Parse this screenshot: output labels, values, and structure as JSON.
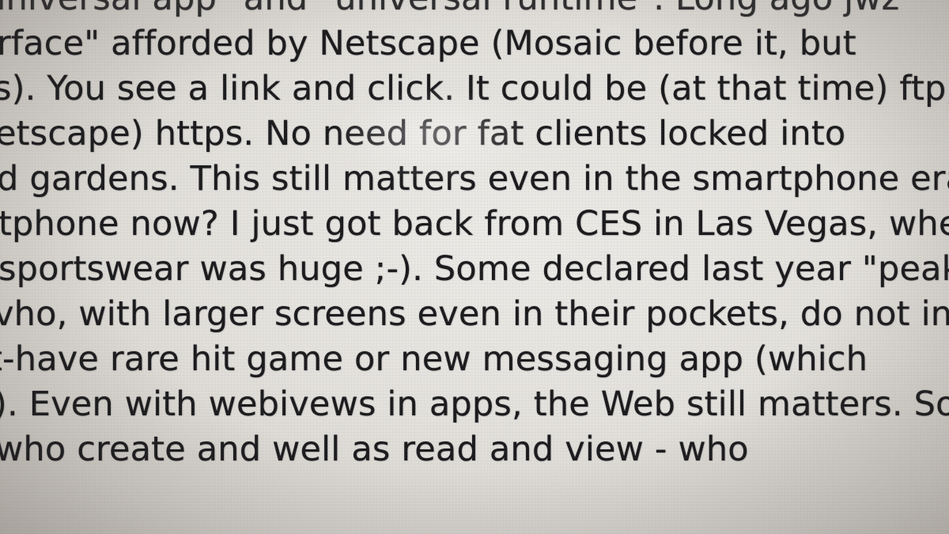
{
  "document": {
    "lines": [
      "universal app\" and \"universal runtime\". Long ago jwz",
      "rface\" afforded by Netscape (Mosaic before it, but",
      "s). You see a link and click. It could be (at that time) ftp,",
      "etscape) https. No need for fat clients locked into",
      "d gardens. This still matters even in the smartphone era.",
      "tphone now? I just got back from CES in Las Vegas, wher",
      "sportswear was huge ;-). Some declared last year \"peak",
      "vho, with larger screens even in their pockets, do not inst",
      "t-have rare hit game or new messaging app (which",
      "). Even with webivews in apps, the Web still matters. So th",
      "who create and well as read and view - who"
    ]
  }
}
